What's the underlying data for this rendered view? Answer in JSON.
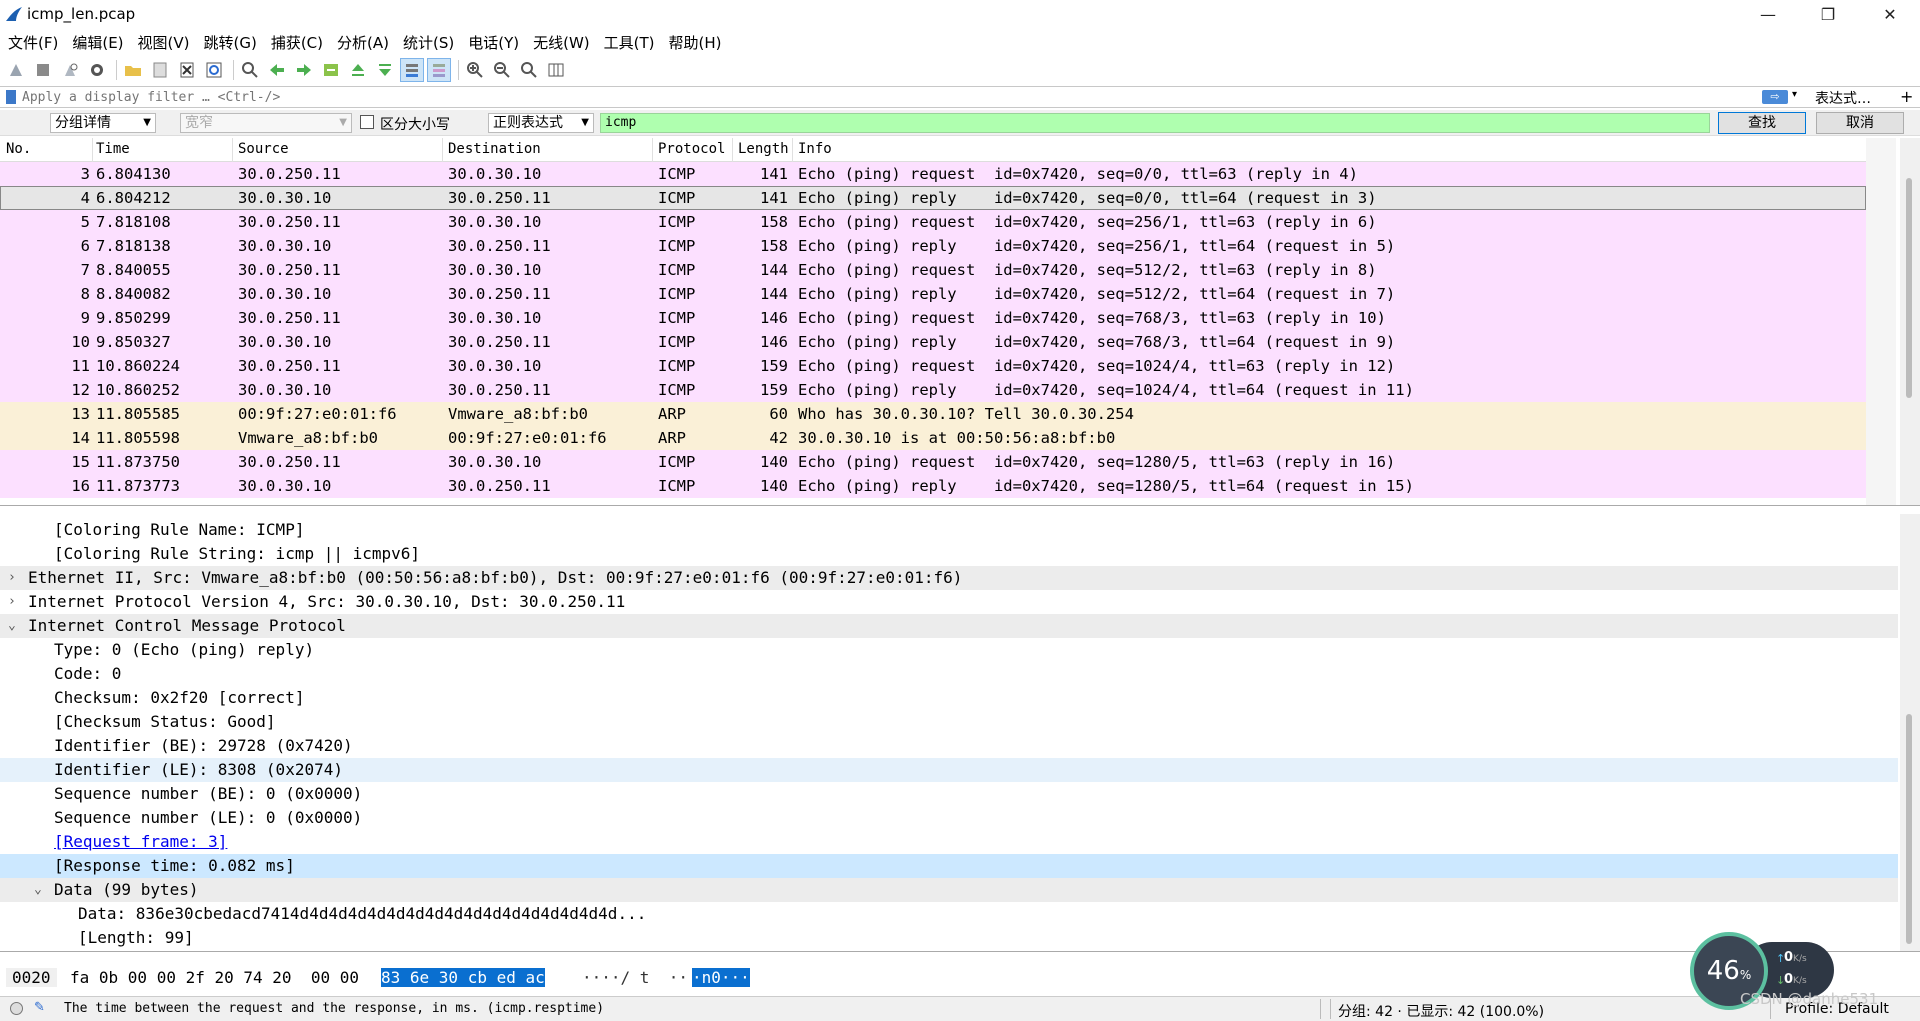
{
  "window": {
    "title": "icmp_len.pcap"
  },
  "menu": [
    "文件(F)",
    "编辑(E)",
    "视图(V)",
    "跳转(G)",
    "捕获(C)",
    "分析(A)",
    "统计(S)",
    "电话(Y)",
    "无线(W)",
    "工具(T)",
    "帮助(H)"
  ],
  "filter": {
    "placeholder": "Apply a display filter … <Ctrl-/>",
    "expression_label": "表达式…",
    "plus_label": "+"
  },
  "find": {
    "scope": "分组详情",
    "charset": "宽窄",
    "case_label": "区分大小写",
    "mode": "正则表达式",
    "query": "icmp",
    "find_label": "查找",
    "cancel_label": "取消"
  },
  "packet_list": {
    "columns": [
      "No.",
      "Time",
      "Source",
      "Destination",
      "Protocol",
      "Length",
      "Info"
    ],
    "rows": [
      {
        "no": "3",
        "time": "6.804130",
        "src": "30.0.250.11",
        "dst": "30.0.30.10",
        "proto": "ICMP",
        "len": "141",
        "info": "Echo (ping) request  id=0x7420, seq=0/0, ttl=63 (reply in 4)",
        "kind": "icmp"
      },
      {
        "no": "4",
        "time": "6.804212",
        "src": "30.0.30.10",
        "dst": "30.0.250.11",
        "proto": "ICMP",
        "len": "141",
        "info": "Echo (ping) reply    id=0x7420, seq=0/0, ttl=64 (request in 3)",
        "kind": "selected"
      },
      {
        "no": "5",
        "time": "7.818108",
        "src": "30.0.250.11",
        "dst": "30.0.30.10",
        "proto": "ICMP",
        "len": "158",
        "info": "Echo (ping) request  id=0x7420, seq=256/1, ttl=63 (reply in 6)",
        "kind": "icmp"
      },
      {
        "no": "6",
        "time": "7.818138",
        "src": "30.0.30.10",
        "dst": "30.0.250.11",
        "proto": "ICMP",
        "len": "158",
        "info": "Echo (ping) reply    id=0x7420, seq=256/1, ttl=64 (request in 5)",
        "kind": "icmp"
      },
      {
        "no": "7",
        "time": "8.840055",
        "src": "30.0.250.11",
        "dst": "30.0.30.10",
        "proto": "ICMP",
        "len": "144",
        "info": "Echo (ping) request  id=0x7420, seq=512/2, ttl=63 (reply in 8)",
        "kind": "icmp"
      },
      {
        "no": "8",
        "time": "8.840082",
        "src": "30.0.30.10",
        "dst": "30.0.250.11",
        "proto": "ICMP",
        "len": "144",
        "info": "Echo (ping) reply    id=0x7420, seq=512/2, ttl=64 (request in 7)",
        "kind": "icmp"
      },
      {
        "no": "9",
        "time": "9.850299",
        "src": "30.0.250.11",
        "dst": "30.0.30.10",
        "proto": "ICMP",
        "len": "146",
        "info": "Echo (ping) request  id=0x7420, seq=768/3, ttl=63 (reply in 10)",
        "kind": "icmp"
      },
      {
        "no": "10",
        "time": "9.850327",
        "src": "30.0.30.10",
        "dst": "30.0.250.11",
        "proto": "ICMP",
        "len": "146",
        "info": "Echo (ping) reply    id=0x7420, seq=768/3, ttl=64 (request in 9)",
        "kind": "icmp"
      },
      {
        "no": "11",
        "time": "10.860224",
        "src": "30.0.250.11",
        "dst": "30.0.30.10",
        "proto": "ICMP",
        "len": "159",
        "info": "Echo (ping) request  id=0x7420, seq=1024/4, ttl=63 (reply in 12)",
        "kind": "icmp"
      },
      {
        "no": "12",
        "time": "10.860252",
        "src": "30.0.30.10",
        "dst": "30.0.250.11",
        "proto": "ICMP",
        "len": "159",
        "info": "Echo (ping) reply    id=0x7420, seq=1024/4, ttl=64 (request in 11)",
        "kind": "icmp"
      },
      {
        "no": "13",
        "time": "11.805585",
        "src": "00:9f:27:e0:01:f6",
        "dst": "Vmware_a8:bf:b0",
        "proto": "ARP",
        "len": "60",
        "info": "Who has 30.0.30.10? Tell 30.0.30.254",
        "kind": "arp"
      },
      {
        "no": "14",
        "time": "11.805598",
        "src": "Vmware_a8:bf:b0",
        "dst": "00:9f:27:e0:01:f6",
        "proto": "ARP",
        "len": "42",
        "info": "30.0.30.10 is at 00:50:56:a8:bf:b0",
        "kind": "arp"
      },
      {
        "no": "15",
        "time": "11.873750",
        "src": "30.0.250.11",
        "dst": "30.0.30.10",
        "proto": "ICMP",
        "len": "140",
        "info": "Echo (ping) request  id=0x7420, seq=1280/5, ttl=63 (reply in 16)",
        "kind": "icmp"
      },
      {
        "no": "16",
        "time": "11.873773",
        "src": "30.0.30.10",
        "dst": "30.0.250.11",
        "proto": "ICMP",
        "len": "140",
        "info": "Echo (ping) reply    id=0x7420, seq=1280/5, ttl=64 (request in 15)",
        "kind": "icmp"
      }
    ]
  },
  "details": [
    {
      "text": "[Coloring Rule Name: ICMP]",
      "indent": 2,
      "style": ""
    },
    {
      "text": "[Coloring Rule String: icmp || icmpv6]",
      "indent": 2,
      "style": ""
    },
    {
      "text": "Ethernet II, Src: Vmware_a8:bf:b0 (00:50:56:a8:bf:b0), Dst: 00:9f:27:e0:01:f6 (00:9f:27:e0:01:f6)",
      "indent": 1,
      "style": "grey",
      "exp": "›"
    },
    {
      "text": "Internet Protocol Version 4, Src: 30.0.30.10, Dst: 30.0.250.11",
      "indent": 1,
      "style": "",
      "exp": "›"
    },
    {
      "text": "Internet Control Message Protocol",
      "indent": 1,
      "style": "grey",
      "exp": "⌄"
    },
    {
      "text": "Type: 0 (Echo (ping) reply)",
      "indent": 2,
      "style": ""
    },
    {
      "text": "Code: 0",
      "indent": 2,
      "style": ""
    },
    {
      "text": "Checksum: 0x2f20 [correct]",
      "indent": 2,
      "style": ""
    },
    {
      "text": "[Checksum Status: Good]",
      "indent": 2,
      "style": ""
    },
    {
      "text": "Identifier (BE): 29728 (0x7420)",
      "indent": 2,
      "style": ""
    },
    {
      "text": "Identifier (LE): 8308 (0x2074)",
      "indent": 2,
      "style": "hl"
    },
    {
      "text": "Sequence number (BE): 0 (0x0000)",
      "indent": 2,
      "style": ""
    },
    {
      "text": "Sequence number (LE): 0 (0x0000)",
      "indent": 2,
      "style": ""
    },
    {
      "text": "[Request frame: 3]",
      "indent": 2,
      "style": "link"
    },
    {
      "text": "[Response time: 0.082 ms]",
      "indent": 2,
      "style": "sel"
    },
    {
      "text": "Data (99 bytes)",
      "indent": 2,
      "style": "grey",
      "exp": "⌄"
    },
    {
      "text": "Data: 836e30cbedacd7414d4d4d4d4d4d4d4d4d4d4d4d4d4d4d4d4d...",
      "indent": 3,
      "style": ""
    },
    {
      "text": "[Length: 99]",
      "indent": 3,
      "style": ""
    }
  ],
  "bytes": {
    "offset": "0020",
    "hex_plain": "fa 0b 00 00 2f 20 74 20  00 00",
    "hex_hl": "83 6e 30 cb ed ac",
    "ascii_plain": "····/ t  ··",
    "ascii_hl": "·n0···"
  },
  "status": {
    "text": "The time between the request and the response, in ms. (icmp.resptime)",
    "counts": "分组: 42 · 已显示: 42 (100.0%)",
    "profile": "Profile: Default"
  },
  "netmon": {
    "percent": "46",
    "unit": "%",
    "up": "0",
    "down": "0",
    "rate_unit": "K/s"
  },
  "watermark": "CSDN @danhe531"
}
